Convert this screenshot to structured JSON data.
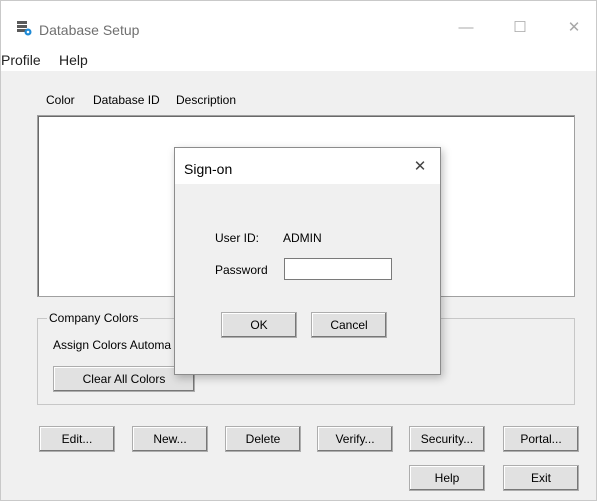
{
  "window": {
    "title": "Database Setup",
    "icon": "database-icon",
    "controls": {
      "minimize": "—",
      "maximize": "☐",
      "close": "✕"
    }
  },
  "menubar": {
    "items": [
      "Profile",
      "Help"
    ]
  },
  "list": {
    "columns": [
      "Color",
      "Database ID",
      "Description"
    ],
    "rows": []
  },
  "company_colors": {
    "label": "Company Colors",
    "assign_label": "Assign Colors Automa",
    "clear_button": "Clear All Colors"
  },
  "buttons": {
    "edit": "Edit...",
    "new": "New...",
    "delete": "Delete",
    "verify": "Verify...",
    "security": "Security...",
    "portal": "Portal...",
    "help": "Help",
    "exit": "Exit"
  },
  "signon_dialog": {
    "title": "Sign-on",
    "close": "✕",
    "user_id_label": "User ID:",
    "user_id_value": "ADMIN",
    "password_label": "Password",
    "password_value": "",
    "ok": "OK",
    "cancel": "Cancel"
  }
}
